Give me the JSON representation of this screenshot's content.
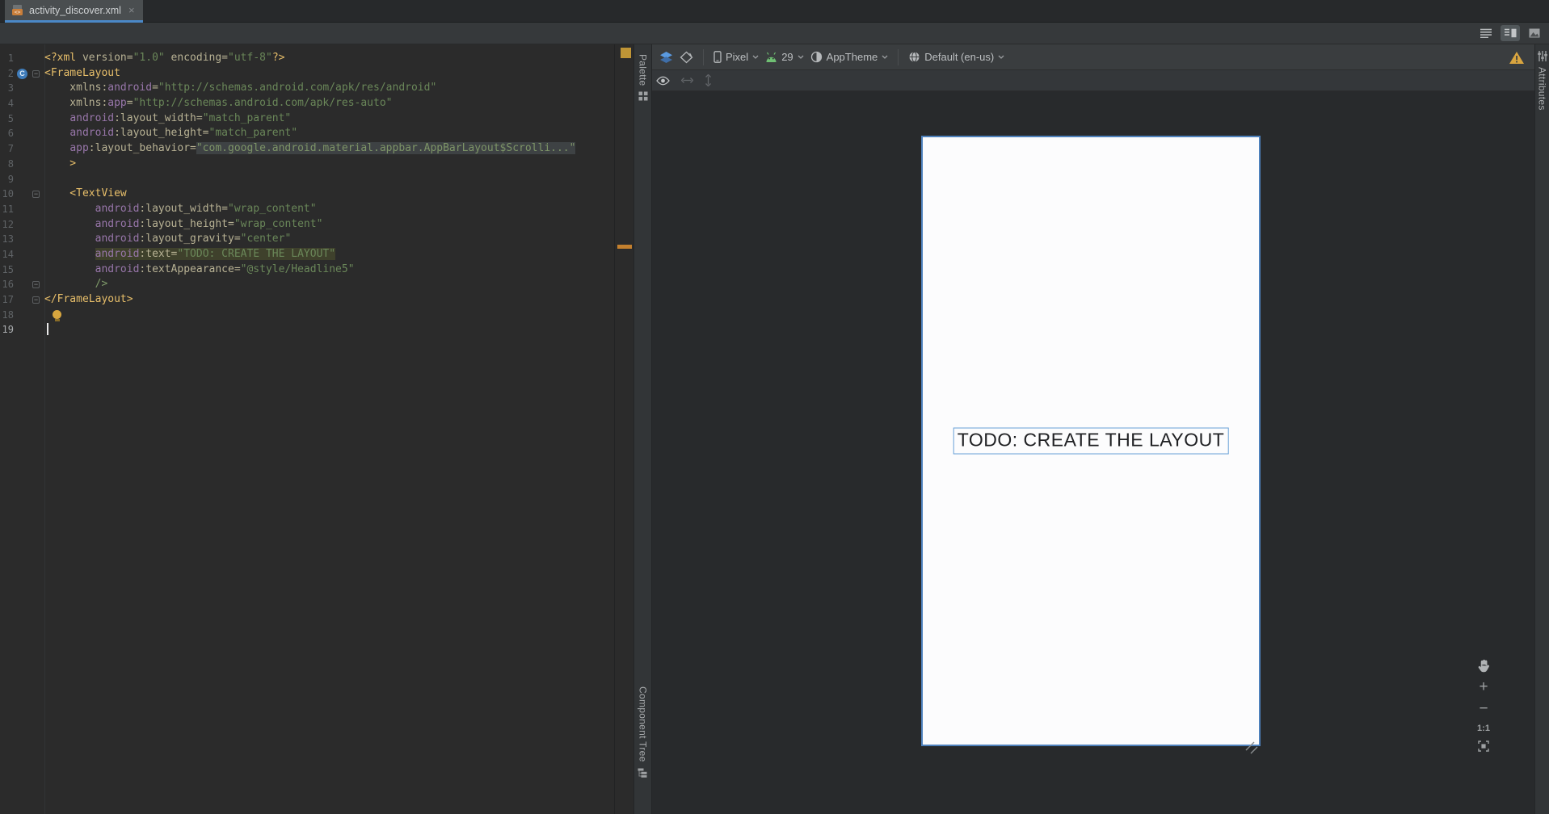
{
  "window": {
    "tab_title": "activity_discover.xml",
    "tab_close": "×"
  },
  "editor": {
    "lines": [
      {
        "n": 1,
        "segs": [
          {
            "k": "tag",
            "t": "<?xml "
          },
          {
            "k": "plain",
            "t": "version="
          },
          {
            "k": "str",
            "t": "\"1.0\""
          },
          {
            "k": "plain",
            "t": " encoding="
          },
          {
            "k": "str",
            "t": "\"utf-8\""
          },
          {
            "k": "tag",
            "t": "?>"
          }
        ]
      },
      {
        "n": 2,
        "fold": true,
        "gutter": "class",
        "segs": [
          {
            "k": "tag",
            "t": "<FrameLayout"
          }
        ]
      },
      {
        "n": 3,
        "segs": [
          {
            "k": "plain",
            "t": "    xmlns:"
          },
          {
            "k": "ns",
            "t": "android"
          },
          {
            "k": "plain",
            "t": "="
          },
          {
            "k": "str",
            "t": "\"http://schemas.android.com/apk/res/android\""
          }
        ]
      },
      {
        "n": 4,
        "segs": [
          {
            "k": "plain",
            "t": "    xmlns:"
          },
          {
            "k": "ns",
            "t": "app"
          },
          {
            "k": "plain",
            "t": "="
          },
          {
            "k": "str",
            "t": "\"http://schemas.android.com/apk/res-auto\""
          }
        ]
      },
      {
        "n": 5,
        "segs": [
          {
            "k": "plain",
            "t": "    "
          },
          {
            "k": "ns",
            "t": "android"
          },
          {
            "k": "plain",
            "t": ":layout_width="
          },
          {
            "k": "str",
            "t": "\"match_parent\""
          }
        ]
      },
      {
        "n": 6,
        "segs": [
          {
            "k": "plain",
            "t": "    "
          },
          {
            "k": "ns",
            "t": "android"
          },
          {
            "k": "plain",
            "t": ":layout_height="
          },
          {
            "k": "str",
            "t": "\"match_parent\""
          }
        ]
      },
      {
        "n": 7,
        "segs": [
          {
            "k": "plain",
            "t": "    "
          },
          {
            "k": "ns",
            "t": "app"
          },
          {
            "k": "plain",
            "t": ":layout_behavior="
          },
          {
            "k": "str",
            "fold": true,
            "t": "\"com.google.android.material.appbar.AppBarLayout$Scrolli...\""
          }
        ]
      },
      {
        "n": 8,
        "segs": [
          {
            "k": "tag",
            "t": "    >"
          }
        ]
      },
      {
        "n": 9,
        "segs": []
      },
      {
        "n": 10,
        "fold": true,
        "segs": [
          {
            "k": "tag",
            "t": "    <TextView"
          }
        ]
      },
      {
        "n": 11,
        "segs": [
          {
            "k": "plain",
            "t": "        "
          },
          {
            "k": "ns",
            "t": "android"
          },
          {
            "k": "plain",
            "t": ":layout_width="
          },
          {
            "k": "str",
            "t": "\"wrap_content\""
          }
        ]
      },
      {
        "n": 12,
        "segs": [
          {
            "k": "plain",
            "t": "        "
          },
          {
            "k": "ns",
            "t": "android"
          },
          {
            "k": "plain",
            "t": ":layout_height="
          },
          {
            "k": "str",
            "t": "\"wrap_content\""
          }
        ]
      },
      {
        "n": 13,
        "segs": [
          {
            "k": "plain",
            "t": "        "
          },
          {
            "k": "ns",
            "t": "android"
          },
          {
            "k": "plain",
            "t": ":layout_gravity="
          },
          {
            "k": "str",
            "t": "\"center\""
          }
        ]
      },
      {
        "n": 14,
        "segs": [
          {
            "k": "plain",
            "t": "        "
          },
          {
            "k": "ns",
            "t": "android",
            "hl": true
          },
          {
            "k": "plain",
            "t": ":text=",
            "hl": true
          },
          {
            "k": "str",
            "t": "\"TODO: CREATE THE LAYOUT\"",
            "hl": true
          }
        ]
      },
      {
        "n": 15,
        "segs": [
          {
            "k": "plain",
            "t": "        "
          },
          {
            "k": "ns",
            "t": "android"
          },
          {
            "k": "plain",
            "t": ":textAppearance="
          },
          {
            "k": "str",
            "t": "\"@style/Headline5\""
          }
        ]
      },
      {
        "n": 16,
        "fold": true,
        "segs": [
          {
            "k": "tagend",
            "t": "        />"
          }
        ]
      },
      {
        "n": 17,
        "fold": true,
        "segs": [
          {
            "k": "tag",
            "t": "</FrameLayout>"
          }
        ]
      },
      {
        "n": 18,
        "bulb": true,
        "segs": []
      },
      {
        "n": 19,
        "caret": true,
        "segs": []
      }
    ]
  },
  "designer": {
    "toolbar": {
      "device": "Pixel",
      "api": "29",
      "theme": "AppTheme",
      "locale": "Default (en-us)"
    },
    "canvas_text": "TODO: CREATE THE LAYOUT",
    "zoom": {
      "zoom_in": "+",
      "zoom_out": "−",
      "actual": "1:1"
    }
  },
  "side_tabs": {
    "palette": "Palette",
    "component_tree": "Component Tree",
    "attributes": "Attributes"
  },
  "colors": {
    "accent_blue": "#4a88c7",
    "canvas_border": "#4e81bc",
    "selection_blue": "#68a0d8",
    "warning_yellow": "#d9a53f",
    "android_green": "#6fbf73",
    "string_green": "#6a8759",
    "tag_yellow": "#e8bf6a",
    "ns_purple": "#9876aa"
  }
}
